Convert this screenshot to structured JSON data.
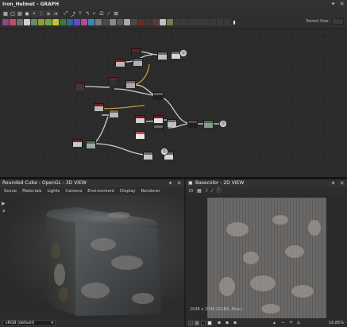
{
  "graph": {
    "title": "Iron_Helmet - GRAPH",
    "parent_size_label": "Parent Size:",
    "actions": [
      "pin-icon",
      "close-icon"
    ]
  },
  "view3d": {
    "title": "Rounded Cube - OpenGL - 3D VIEW",
    "menu": [
      "Scene",
      "Materials",
      "Lights",
      "Camera",
      "Environment",
      "Display",
      "Renderer"
    ],
    "colorspace": "sRGB (default)"
  },
  "view2d": {
    "title": "Basecolor - 2D VIEW",
    "info": "2048 x 2048 (RGBA, 8bpc)",
    "zoom": "16.85%"
  },
  "colors": {
    "node_header_red": "#7a1a1a",
    "panel_bg": "#2b2b2b",
    "title_bg": "#323232"
  }
}
